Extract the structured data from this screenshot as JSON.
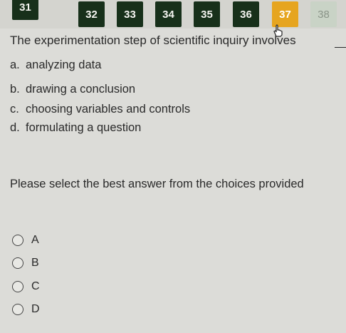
{
  "question_nav": {
    "numbers": [
      "31",
      "32",
      "33",
      "34",
      "35",
      "36",
      "37",
      "38"
    ],
    "current": "37"
  },
  "question": {
    "stem": "The experimentation step of scientific inquiry involves",
    "choices": [
      {
        "letter": "a.",
        "text": "analyzing data"
      },
      {
        "letter": "b.",
        "text": "drawing a conclusion"
      },
      {
        "letter": "c.",
        "text": "choosing variables and controls"
      },
      {
        "letter": "d.",
        "text": "formulating a question"
      }
    ]
  },
  "instruction": "Please select the best answer from the choices provided",
  "options": [
    "A",
    "B",
    "C",
    "D"
  ]
}
